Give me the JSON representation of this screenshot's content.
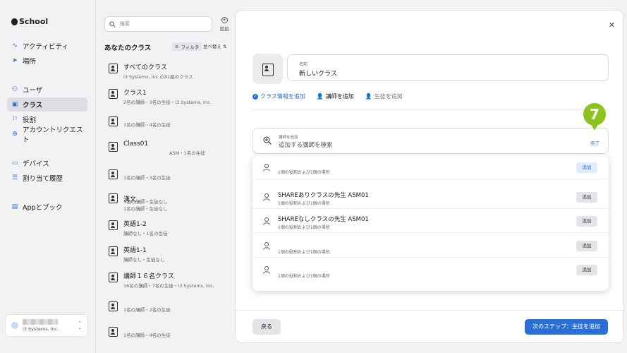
{
  "brand": {
    "name": "School"
  },
  "sidebar": {
    "items": [
      {
        "label": "アクティビティ",
        "icon": "activity-icon"
      },
      {
        "label": "場所",
        "icon": "location-icon"
      },
      {
        "label": "ユーザ",
        "icon": "users-icon"
      },
      {
        "label": "クラス",
        "icon": "class-icon",
        "active": true
      },
      {
        "label": "役割",
        "icon": "flag-icon"
      },
      {
        "label": "アカウントリクエスト",
        "icon": "account-request-icon"
      },
      {
        "label": "デバイス",
        "icon": "device-icon"
      },
      {
        "label": "割り当て履歴",
        "icon": "history-icon"
      },
      {
        "label": "Appとブック",
        "icon": "apps-icon"
      }
    ],
    "user": {
      "org": "i3 Systems, Inc."
    }
  },
  "list": {
    "search_placeholder": "検索",
    "add_label": "追加",
    "title": "あなたのクラス",
    "filter_label": "フィルタ",
    "sort_label": "並べ替え",
    "classes": [
      {
        "name": "すべてのクラス",
        "sub": "i3 Systems, Inc.の81組のクラス"
      },
      {
        "name": "クラス1",
        "sub": "2名の講師・3名の生徒・i3 Systems, Inc."
      },
      {
        "name": "",
        "sub": "1名の講師・4名の生徒"
      },
      {
        "name": "Class01",
        "sub": "ASM・1名の生徒"
      },
      {
        "name": "",
        "sub": "1名の講師・3名の生徒"
      },
      {
        "name": "",
        "sub": "1名の講師・生徒なし"
      },
      {
        "name": "漢文",
        "sub": "1名の講師・生徒なし"
      },
      {
        "name": "英語1-2",
        "sub": "講師なし・1名の生徒"
      },
      {
        "name": "英語1-1",
        "sub": "講師なし・生徒なし"
      },
      {
        "name": "講師１６名クラス",
        "sub": "16名の講師・7名の生徒・i3 Systems, Inc."
      },
      {
        "name": "",
        "sub": "1名の講師・2名の生徒"
      },
      {
        "name": "",
        "sub": "1名の講師・4名の生徒"
      }
    ]
  },
  "panel": {
    "name_label": "名前",
    "name_value": "新しいクラス",
    "steps": [
      {
        "label": "クラス情報を追加",
        "state": "done"
      },
      {
        "label": "講師を追加",
        "state": "current"
      },
      {
        "label": "生徒を追加",
        "state": "pending"
      }
    ],
    "teacher_search": {
      "label": "講師を追加",
      "placeholder": "追加する講師を検索",
      "done_label": "完了"
    },
    "badge_number": "7",
    "badge_color": "#8dc21f",
    "results": [
      {
        "title": "",
        "sub": "1個の役割および1個の場所",
        "button": "追加",
        "selected": true
      },
      {
        "title": "SHAREありクラスの先生 ASM01",
        "sub": "1個の役割および1個の場所",
        "button": "追加",
        "selected": false
      },
      {
        "title": "SHAREなしクラスの先生 ASM01",
        "sub": "1個の役割および1個の場所",
        "button": "追加",
        "selected": false
      },
      {
        "title": "",
        "sub": "1個の役割および1個の場所",
        "button": "追加",
        "selected": false
      },
      {
        "title": "",
        "sub": "1個の役割および1個の場所",
        "button": "追加",
        "selected": false
      }
    ],
    "back_label": "戻る",
    "next_label": "次のステップ：生徒を追加"
  },
  "colors": {
    "accent": "#2a6fd6",
    "badge": "#8dc21f"
  }
}
